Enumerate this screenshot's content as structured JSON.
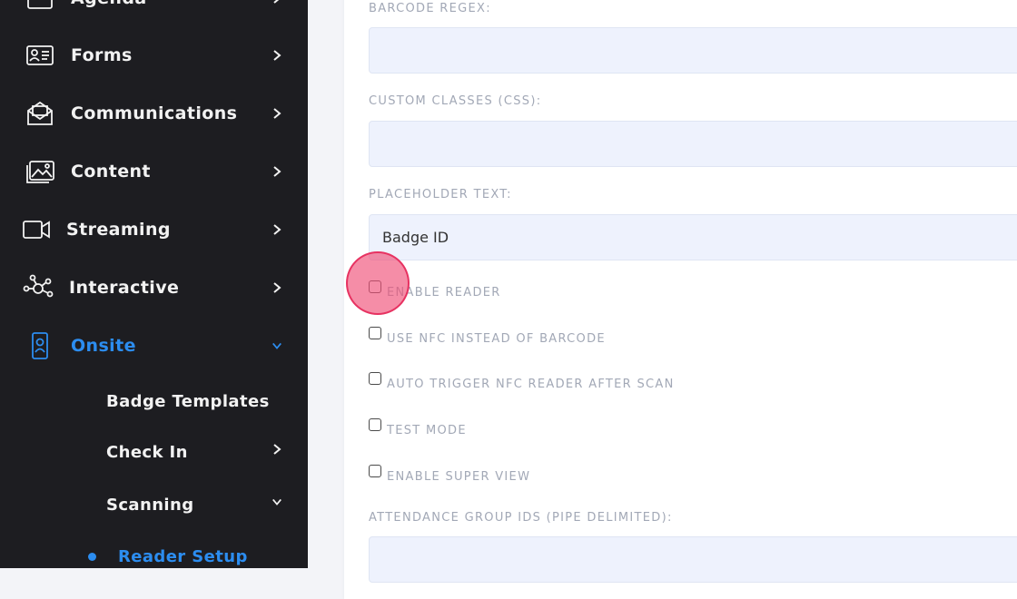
{
  "sidebar": {
    "items": [
      {
        "label": "Agenda",
        "icon": "calendar-icon"
      },
      {
        "label": "Forms",
        "icon": "id-card-icon"
      },
      {
        "label": "Communications",
        "icon": "envelope-icon"
      },
      {
        "label": "Content",
        "icon": "images-icon"
      },
      {
        "label": "Streaming",
        "icon": "video-camera-icon"
      },
      {
        "label": "Interactive",
        "icon": "network-icon"
      },
      {
        "label": "Onsite",
        "icon": "badge-icon"
      }
    ],
    "sub_items": [
      {
        "label": "Badge Templates"
      },
      {
        "label": "Check In"
      },
      {
        "label": "Scanning"
      },
      {
        "label": "Reader Setup"
      }
    ]
  },
  "form": {
    "barcode_regex_label": "BARCODE REGEX:",
    "barcode_regex_value": "",
    "custom_classes_label": "CUSTOM CLASSES (CSS):",
    "custom_classes_value": "",
    "placeholder_text_label": "PLACEHOLDER TEXT:",
    "placeholder_text_value": "Badge ID",
    "checkboxes": [
      {
        "label": "ENABLE READER",
        "checked": false
      },
      {
        "label": "USE NFC INSTEAD OF BARCODE",
        "checked": false
      },
      {
        "label": "AUTO TRIGGER NFC READER AFTER SCAN",
        "checked": false
      },
      {
        "label": "TEST MODE",
        "checked": false
      },
      {
        "label": "ENABLE SUPER VIEW",
        "checked": false
      }
    ],
    "attendance_group_label": "ATTENDANCE GROUP IDS (PIPE DELIMITED):",
    "attendance_group_value": ""
  },
  "colors": {
    "sidebar_bg": "#1d1d21",
    "accent": "#2c8df0",
    "input_bg": "#eef2fd",
    "label_gray": "#a2a8b6",
    "click_indicator": "#f05078"
  }
}
